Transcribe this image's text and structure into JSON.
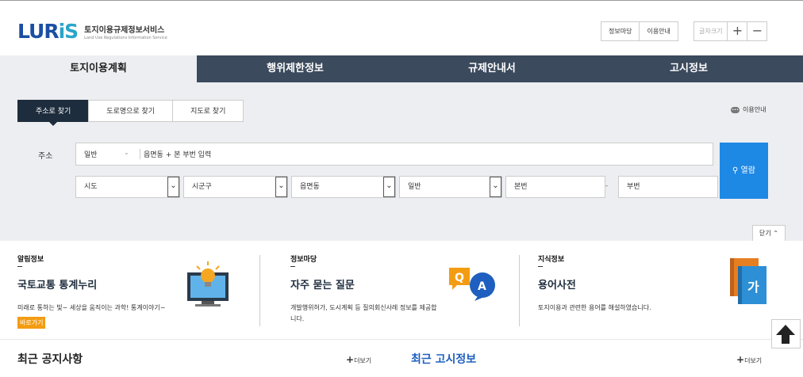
{
  "header": {
    "logo_mark": "LURIS",
    "logo_title": "토지이용규제정보서비스",
    "logo_subtitle": "Land Use Regulations Information Service",
    "nav": [
      "정보마당",
      "이용안내"
    ],
    "font_size_label": "글자크기",
    "font_plus": "+",
    "font_minus": "−"
  },
  "main_tabs": [
    "토지이용계획",
    "행위제한정보",
    "규제안내서",
    "고시정보"
  ],
  "search": {
    "sub_tabs": [
      "주소로 찾기",
      "도로명으로 찾기",
      "지도로 찾기"
    ],
    "help_label": "이용안내",
    "address_label": "주소",
    "address_type": "일반",
    "address_placeholder": "읍면동 + 본 부번 입력",
    "selects": [
      "시도",
      "시군구",
      "읍면동",
      "일반"
    ],
    "main_number": "본번",
    "sub_number": "부번",
    "dash": "-",
    "view_button": "열람",
    "close_button": "닫기"
  },
  "info": {
    "notice": {
      "title": "알림정보",
      "headline": "국토교통 통계누리",
      "desc": "미래로 통하는 빛~ 세상을 움직이는 과학! 통계이야기~",
      "go_button": "바로가기"
    },
    "board": {
      "title": "정보마당",
      "headline": "자주 묻는 질문",
      "desc": "개발행위허가, 도시계획 등 질의회신사례 정보를 제공합니다.",
      "qa_q": "Q",
      "qa_a": "A"
    },
    "knowledge": {
      "title": "지식정보",
      "headline": "용어사전",
      "desc": "토지이용과 관련한 용어를 해설하였습니다.",
      "book_glyph": "가"
    }
  },
  "bottom": {
    "left_title": "최근 공지사항",
    "right_title": "최근 고시정보",
    "more_label": "더보기"
  },
  "colors": {
    "nav_dark": "#3b4a5c",
    "panel_bg": "#eceef1",
    "accent_blue": "#1e88e5",
    "accent_orange": "#f39c12"
  },
  "icons": [
    "monitor-lightbulb-icon",
    "qa-bubbles-icon",
    "dictionary-books-icon",
    "arrow-up-icon",
    "speech-bubble-icon",
    "chevron-down-icon",
    "search-icon"
  ]
}
